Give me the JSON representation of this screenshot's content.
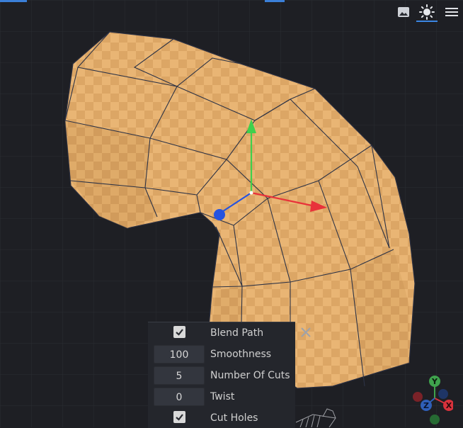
{
  "toolbar": {
    "icons": [
      "image-icon",
      "sun-icon",
      "hamburger-menu-icon"
    ],
    "active": "sun-icon",
    "accent_color": "#3b86e3"
  },
  "operator_panel": {
    "rows": [
      {
        "type": "checkbox",
        "checked": true,
        "label": "Blend Path"
      },
      {
        "type": "number",
        "value": "100",
        "label": "Smoothness"
      },
      {
        "type": "number",
        "value": "5",
        "label": "Number Of Cuts"
      },
      {
        "type": "number",
        "value": "0",
        "label": "Twist"
      },
      {
        "type": "checkbox",
        "checked": true,
        "label": "Cut Holes"
      }
    ]
  },
  "axis_gizmo": {
    "labels": {
      "y": "Y",
      "x": "X",
      "z": "Z"
    },
    "colors": {
      "x": "#d8323c",
      "y": "#3fa34d",
      "z": "#2f5fb8"
    }
  },
  "mesh": {
    "color": "#e9b574",
    "transform_arrows": {
      "x": "#e8323a",
      "y": "#3fd04c",
      "z": "#2553e0"
    }
  }
}
